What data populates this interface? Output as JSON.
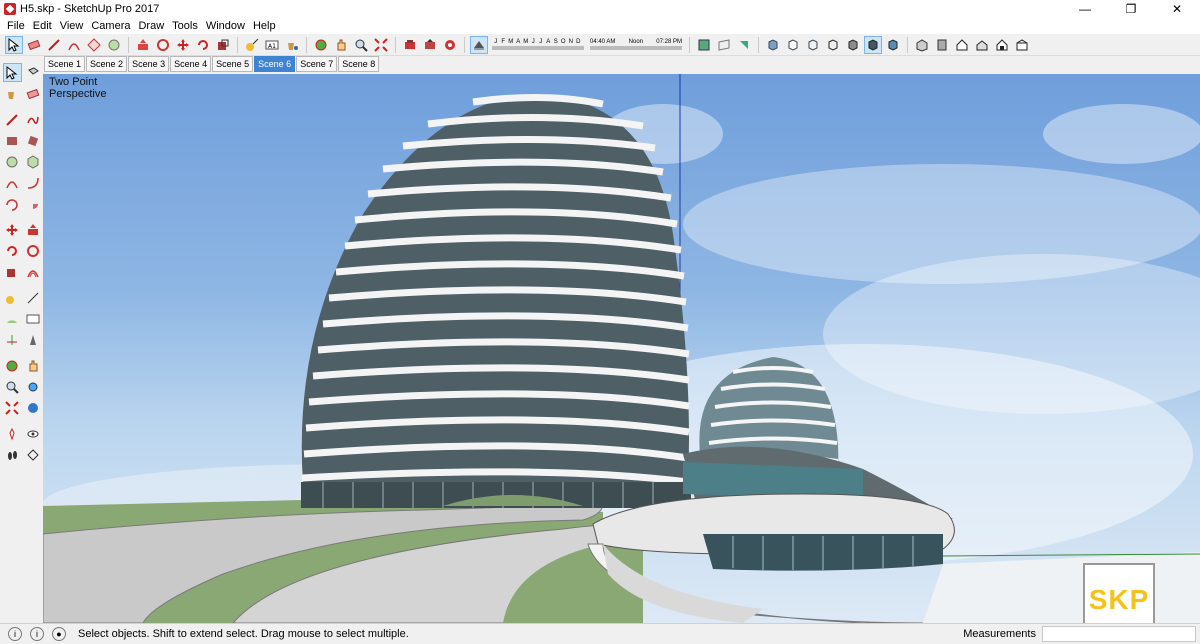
{
  "window": {
    "title": "H5.skp - SketchUp Pro 2017",
    "minimize_glyph": "—",
    "maximize_glyph": "❐",
    "close_glyph": "✕"
  },
  "menu": [
    "File",
    "Edit",
    "View",
    "Camera",
    "Draw",
    "Tools",
    "Window",
    "Help"
  ],
  "shadow_settings": {
    "months": [
      "J",
      "F",
      "M",
      "A",
      "M",
      "J",
      "J",
      "A",
      "S",
      "O",
      "N",
      "D"
    ],
    "time_start": "04:40 AM",
    "time_mid": "Noon",
    "time_end": "07:28 PM"
  },
  "scenes": {
    "tabs": [
      "Scene 1",
      "Scene 2",
      "Scene 3",
      "Scene 4",
      "Scene 5",
      "Scene 6",
      "Scene 7",
      "Scene 8"
    ],
    "active": "Scene 6"
  },
  "viewport": {
    "camera_label_line1": "Two Point",
    "camera_label_line2": "Perspective"
  },
  "status": {
    "message": "Select objects. Shift to extend select. Drag mouse to select multiple.",
    "measurements_label": "Measurements"
  },
  "watermark": "SKP",
  "colors": {
    "active_tab": "#3f84d2",
    "logo_text": "#f4c21a",
    "selection_highlight": "#cde6f7"
  }
}
